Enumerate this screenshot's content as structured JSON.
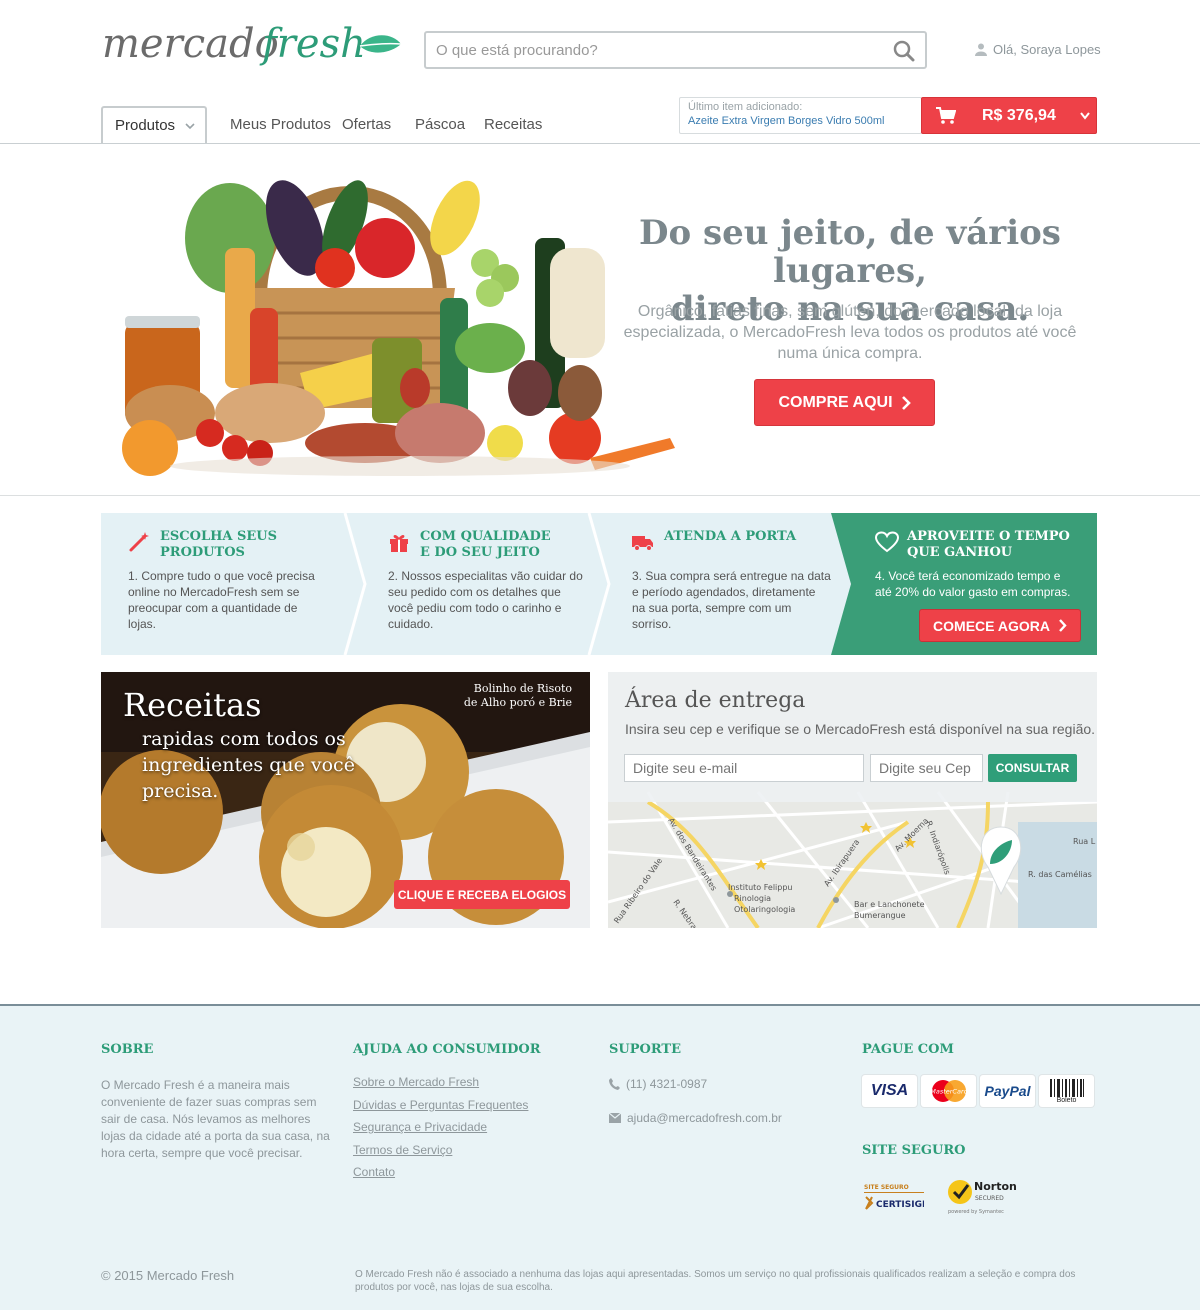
{
  "header": {
    "logo_text": "mercadofresh",
    "search_placeholder": "O que está procurando?",
    "user_greeting": "Olá, Soraya Lopes"
  },
  "nav": {
    "produtos": "Produtos",
    "links": [
      "Meus Produtos",
      "Ofertas",
      "Páscoa",
      "Receitas"
    ],
    "last_item_label": "Último item adicionado:",
    "last_item_value": "Azeite Extra Virgem Borges Vidro 500ml",
    "cart_total": "R$ 376,94"
  },
  "hero": {
    "title_line1": "Do seu jeito, de vários lugares,",
    "title_line2": "direto na sua casa.",
    "subtitle": "Orgânico, fatias finas, sem glúten, do mercado local, da loja especializada, o MercadoFresh leva todos os produtos até você numa única compra.",
    "button": "COMPRE AQUI"
  },
  "steps": [
    {
      "title_l1": "ESCOLHA SEUS",
      "title_l2": "PRODUTOS",
      "text": "1. Compre tudo o que você precisa online no MercadoFresh sem se preocupar com a quantidade de lojas.",
      "icon": "magic-wand-icon"
    },
    {
      "title_l1": "COM QUALIDADE",
      "title_l2": "E DO SEU JEITO",
      "text": "2. Nossos especialitas vão cuidar do seu pedido com os detalhes que você pediu com todo o carinho e cuidado.",
      "icon": "gift-icon"
    },
    {
      "title_l1": "ATENDA A PORTA",
      "title_l2": "",
      "text": "3. Sua compra será entregue na data e período agendados, diretamente na sua porta, sempre com um sorriso.",
      "icon": "truck-icon"
    },
    {
      "title_l1": "APROVEITE O TEMPO",
      "title_l2": "QUE GANHOU",
      "text": "4. Você terá economizado tempo e até 20% do valor gasto em compras.",
      "icon": "heart-icon",
      "button": "COMECE AGORA"
    }
  ],
  "receitas": {
    "title": "Receitas",
    "subtitle": "rapidas com todos os ingredientes que você precisa.",
    "caption_l1": "Bolinho de Risoto",
    "caption_l2": "de Alho poró e Brie",
    "button": "CLIQUE E RECEBA ELOGIOS"
  },
  "entrega": {
    "title": "Área de entrega",
    "subtitle": "Insira seu cep e verifique se o MercadoFresh está disponível na sua região.",
    "email_placeholder": "Digite seu e-mail",
    "cep_placeholder": "Digite seu Cep",
    "button": "CONSULTAR",
    "map_labels": [
      "Av. dos Bandeirantes",
      "Av. Ibirapuera",
      "Av. Moema",
      "R. Indiarópolis",
      "Rua Ribeiro do Vale",
      "R. Nebraska",
      "Instituto Felippu",
      "Rinologia",
      "Otolaringologia",
      "Bar e Lanchonete",
      "Bumerangue",
      "R. das Camélias",
      "Rua L"
    ]
  },
  "footer": {
    "sobre_head": "SOBRE",
    "sobre_text": "O Mercado Fresh é a maneira mais conveniente de fazer suas compras sem sair de casa. Nós levamos as melhores lojas da cidade até a porta da sua casa, na hora certa, sempre que você precisar.",
    "ajuda_head": "AJUDA AO CONSUMIDOR",
    "ajuda_links": [
      "Sobre o Mercado Fresh",
      "Dúvidas e Perguntas Frequentes",
      "Segurança e Privacidade",
      "Termos de Serviço",
      "Contato"
    ],
    "suporte_head": "SUPORTE",
    "phone": "(11) 4321-0987",
    "email": "ajuda@mercadofresh.com.br",
    "pague_head": "PAGUE COM",
    "payment": [
      "VISA",
      "MasterCard",
      "PayPal",
      "Boleto"
    ],
    "seguro_head": "SITE SEGURO",
    "seals": [
      "SITE SEGURO",
      "CERTISIGN",
      "Norton",
      "SECURED",
      "powered by Symantec"
    ],
    "copyright": "© 2015  Mercado Fresh",
    "disclaimer": "O Mercado Fresh não é associado a nenhuma das lojas aqui apresentadas. Somos um serviço no qual profissionais qualificados realizam a seleção e compra dos produtos por você, nas lojas de sua escolha."
  },
  "colors": {
    "brand_green": "#2d9c78",
    "accent_red": "#ee4148",
    "footer_bg": "#e9f3f6"
  }
}
